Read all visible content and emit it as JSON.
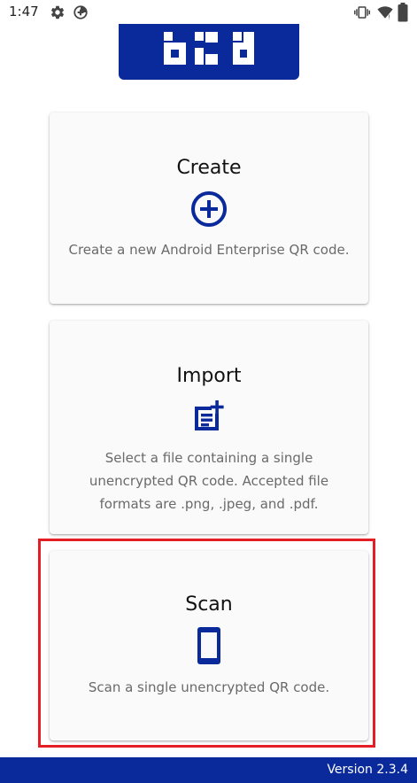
{
  "status_bar": {
    "time": "1:47",
    "left_icons": [
      "gear-icon",
      "data-saver-icon"
    ],
    "right_icons": [
      "vibrate-icon",
      "wifi-icon",
      "battery-icon"
    ]
  },
  "colors": {
    "brand": "#0a2a9c",
    "highlight": "#e31e24",
    "card_background": "#fafafa",
    "description_text": "#6a6a6a"
  },
  "cards": {
    "create": {
      "title": "Create",
      "icon": "add-circle-icon",
      "description": "Create a new Android Enterprise QR code."
    },
    "import": {
      "title": "Import",
      "icon": "post-add-icon",
      "description": "Select a file containing a single unencrypted QR code. Accepted file formats are .png, .jpeg, and .pdf."
    },
    "scan": {
      "title": "Scan",
      "icon": "smartphone-icon",
      "description": "Scan a single unencrypted QR code."
    }
  },
  "footer": {
    "version": "Version 2.3.4"
  }
}
